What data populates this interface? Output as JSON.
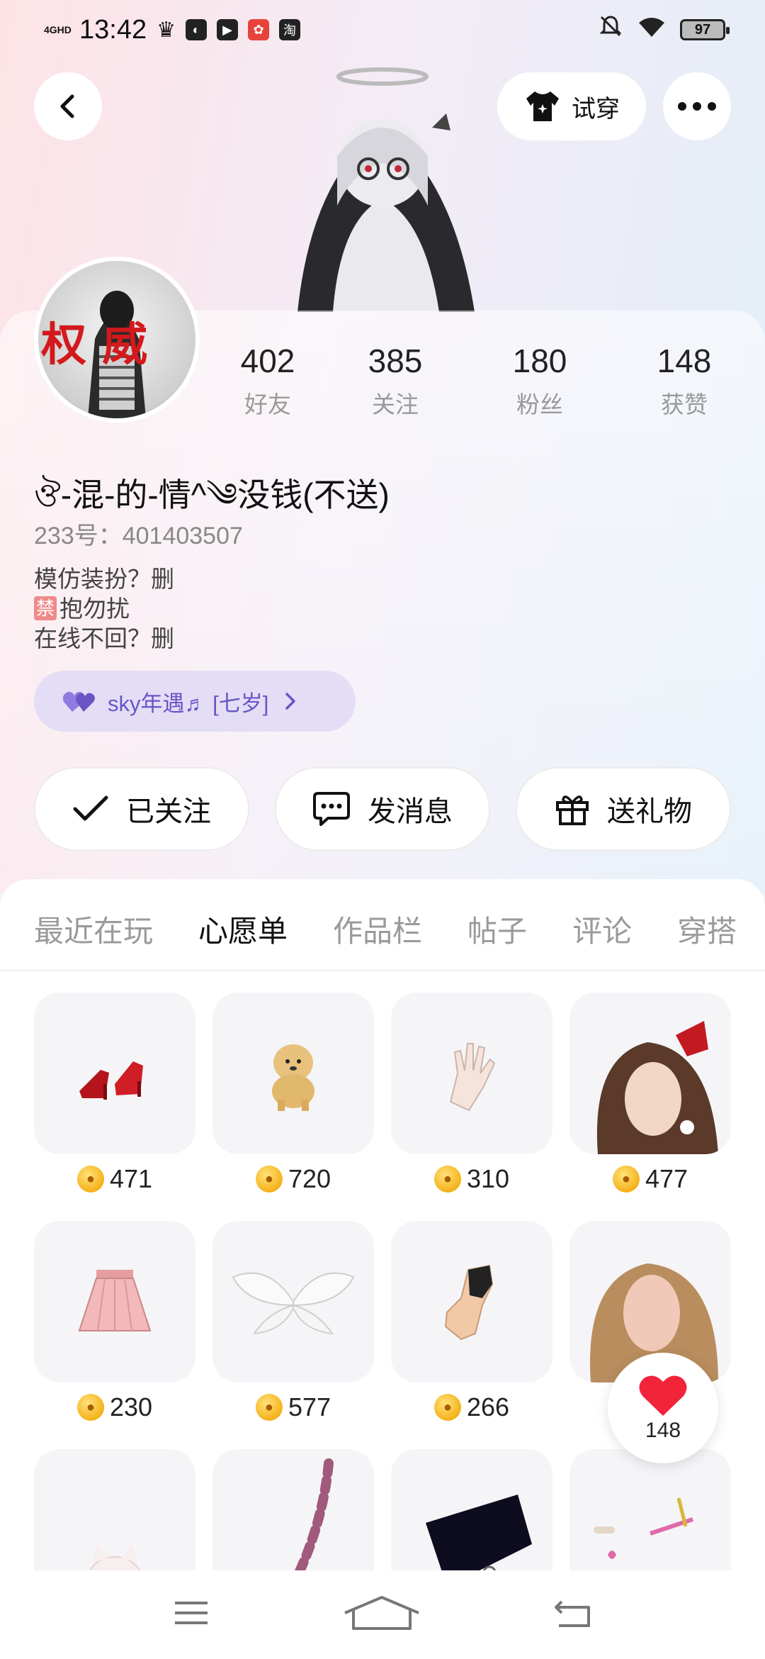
{
  "status_bar": {
    "network": "4GHD",
    "time": "13:42",
    "battery": "97"
  },
  "header": {
    "try_on_label": "试穿"
  },
  "profile": {
    "stats": [
      {
        "num": "402",
        "label": "好友"
      },
      {
        "num": "385",
        "label": "关注"
      },
      {
        "num": "180",
        "label": "粉丝"
      },
      {
        "num": "148",
        "label": "获赞"
      }
    ],
    "nickname": "ঔ-混-的-情^༄没钱(不送)",
    "uid": "233号：401403507",
    "bio_line1": "模仿装扮？删",
    "bio_tag": "禁",
    "bio_line2": "抱勿扰",
    "bio_line3": "在线不回？删",
    "avatar_text": "权 威",
    "badge": "sky年遇♬ [七岁]"
  },
  "actions": {
    "follow": "已关注",
    "message": "发消息",
    "gift": "送礼物"
  },
  "tabs": [
    "最近在玩",
    "心愿单",
    "作品栏",
    "帖子",
    "评论",
    "穿搭"
  ],
  "active_tab": "心愿单",
  "wishlist": [
    {
      "item": "red-heels",
      "price": "471"
    },
    {
      "item": "puppy",
      "price": "720"
    },
    {
      "item": "lace-glove",
      "price": "310"
    },
    {
      "item": "brown-hair",
      "price": "477"
    },
    {
      "item": "pink-skirt",
      "price": "230"
    },
    {
      "item": "angel-wings",
      "price": "577"
    },
    {
      "item": "fishnet-glove",
      "price": "266"
    },
    {
      "item": "blonde-hair",
      "price": ""
    },
    {
      "item": "cat-plush",
      "price": ""
    },
    {
      "item": "striped-tail",
      "price": ""
    },
    {
      "item": "black-collar",
      "price": ""
    },
    {
      "item": "accessories",
      "price": ""
    }
  ],
  "likes": {
    "count": "148"
  },
  "colors": {
    "accent": "#f36b2a",
    "badge_text": "#6a55c6",
    "heart": "#f2243a"
  }
}
